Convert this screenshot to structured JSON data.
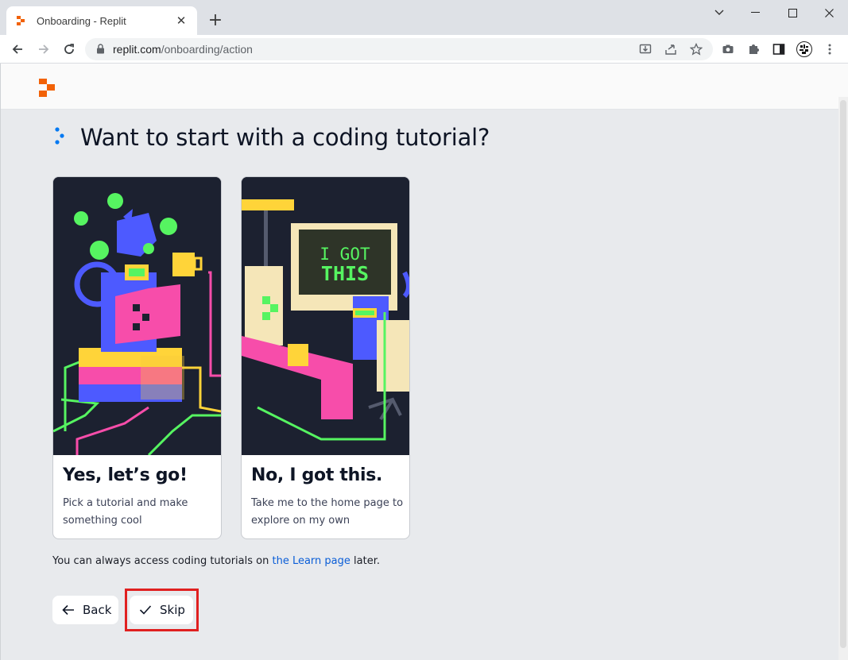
{
  "browser": {
    "tab_title": "Onboarding - Replit",
    "url_host": "replit.com",
    "url_path": "/onboarding/action"
  },
  "page": {
    "heading": "Want to start with a coding tutorial?",
    "cards": [
      {
        "title": "Yes, let’s go!",
        "description": "Pick a tutorial and make something cool"
      },
      {
        "title": "No, I got this.",
        "description": "Take me to the home page to explore on my own",
        "art_text_line1": "I GOT",
        "art_text_line2": "THIS"
      }
    ],
    "hint_prefix": "You can always access coding tutorials on ",
    "hint_link": "the Learn page",
    "hint_suffix": " later.",
    "back_label": "Back",
    "skip_label": "Skip"
  },
  "colors": {
    "brand_orange": "#f26207",
    "dark_art_bg": "#1c2130",
    "link_blue": "#0b5ed7",
    "highlight_red": "#e02020"
  }
}
